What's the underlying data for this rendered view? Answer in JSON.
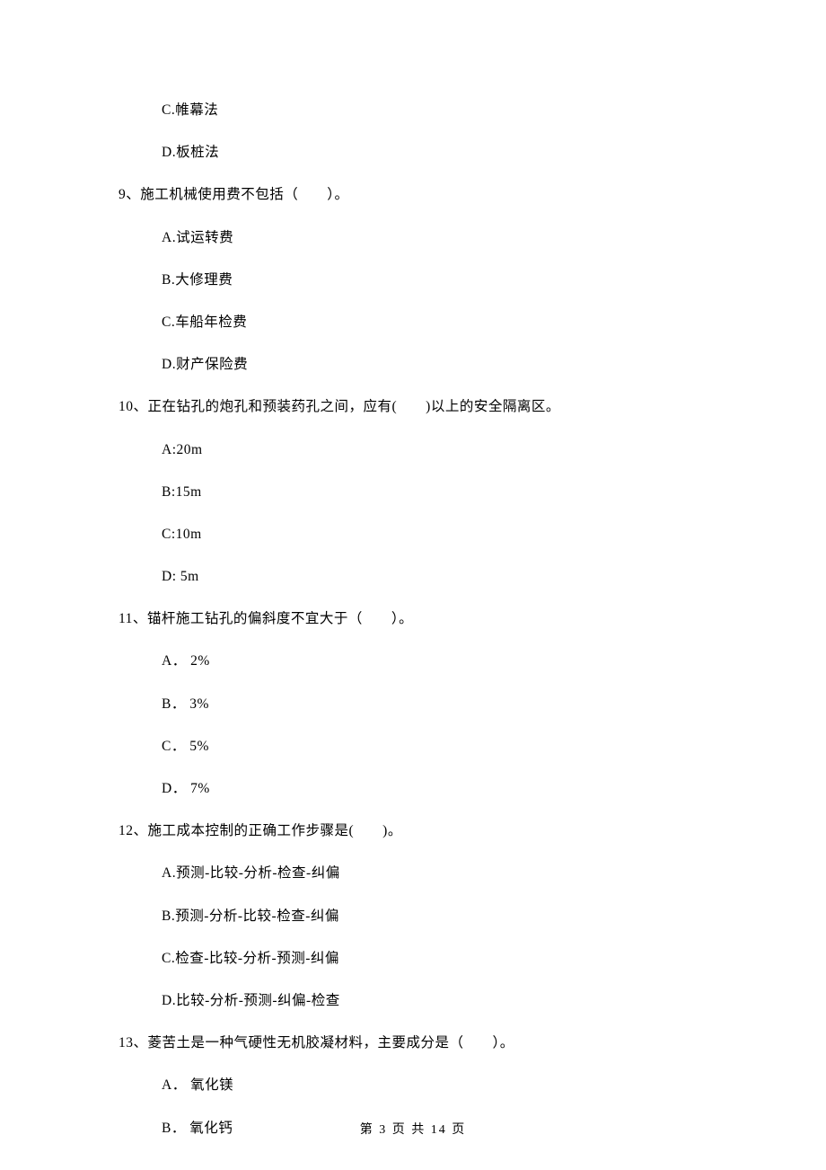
{
  "orphan_options": [
    "C.帷幕法",
    "D.板桩法"
  ],
  "questions": [
    {
      "stem": "9、施工机械使用费不包括（　　）。",
      "options": [
        "A.试运转费",
        "B.大修理费",
        "C.车船年检费",
        "D.财产保险费"
      ]
    },
    {
      "stem": "10、正在钻孔的炮孔和预装药孔之间，应有(　　)以上的安全隔离区。",
      "options": [
        "A:20m",
        "B:15m",
        "C:10m",
        "D: 5m"
      ]
    },
    {
      "stem": "11、锚杆施工钻孔的偏斜度不宜大于（　　）。",
      "options": [
        "A． 2%",
        "B． 3%",
        "C． 5%",
        "D． 7%"
      ]
    },
    {
      "stem": "12、施工成本控制的正确工作步骤是(　　)。",
      "options": [
        "A.预测-比较-分析-检查-纠偏",
        "B.预测-分析-比较-检查-纠偏",
        "C.检查-比较-分析-预测-纠偏",
        "D.比较-分析-预测-纠偏-检查"
      ]
    },
    {
      "stem": "13、菱苦土是一种气硬性无机胶凝材料，主要成分是（　　）。",
      "options": [
        "A． 氧化镁",
        "B． 氧化钙"
      ]
    }
  ],
  "footer": "第 3 页 共 14 页"
}
